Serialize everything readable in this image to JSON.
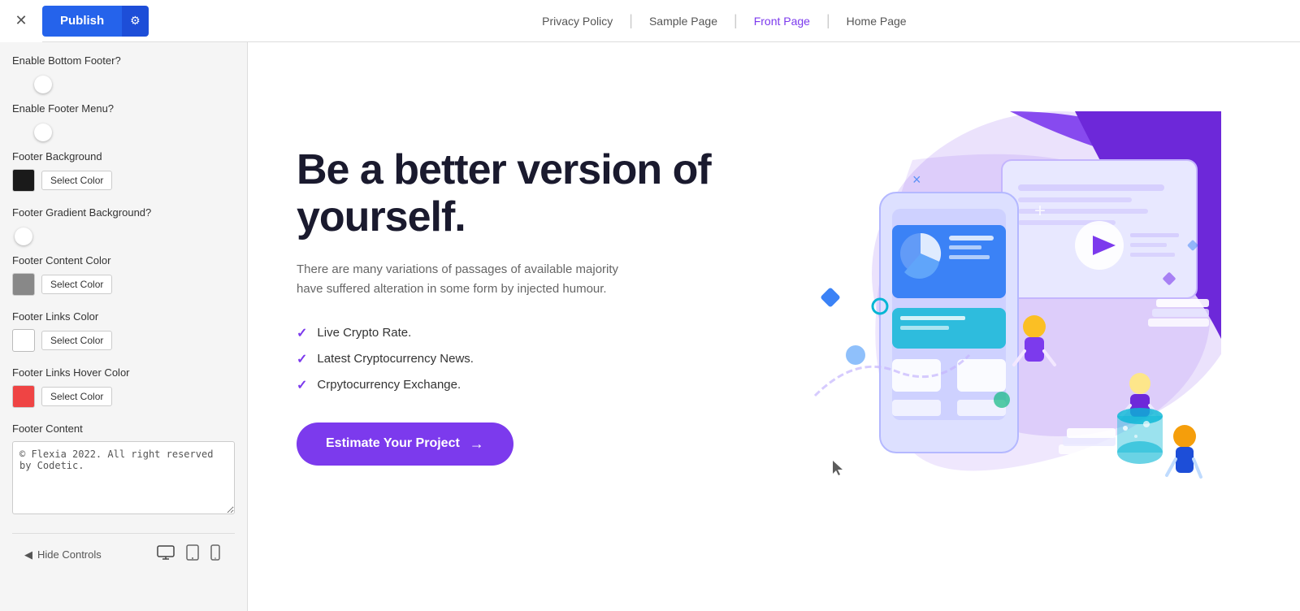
{
  "toolbar": {
    "close_label": "✕",
    "publish_label": "Publish",
    "gear_label": "⚙"
  },
  "top_nav": {
    "items": [
      {
        "label": "Privacy Policy",
        "active": false
      },
      {
        "label": "Sample Page",
        "active": false
      },
      {
        "label": "Front Page",
        "active": true
      },
      {
        "label": "Home Page",
        "active": false
      }
    ]
  },
  "left_panel": {
    "settings": [
      {
        "id": "enable-bottom-footer",
        "label": "Enable Bottom Footer?",
        "type": "toggle",
        "value": true
      },
      {
        "id": "enable-footer-menu",
        "label": "Enable Footer Menu?",
        "type": "toggle",
        "value": true
      },
      {
        "id": "footer-background",
        "label": "Footer Background",
        "type": "color",
        "color": "#1a1a1a",
        "button_label": "Select Color"
      },
      {
        "id": "footer-gradient",
        "label": "Footer Gradient Background?",
        "type": "toggle",
        "value": false
      },
      {
        "id": "footer-content-color",
        "label": "Footer Content Color",
        "type": "color",
        "color": "#888888",
        "button_label": "Select Color"
      },
      {
        "id": "footer-links-color",
        "label": "Footer Links Color",
        "type": "color",
        "color": "#ffffff",
        "button_label": "Select Color"
      },
      {
        "id": "footer-links-hover-color",
        "label": "Footer Links Hover Color",
        "type": "color",
        "color": "#ef4444",
        "button_label": "Select Color"
      },
      {
        "id": "footer-content",
        "label": "Footer Content",
        "type": "textarea",
        "value": "© Flexia 2022. All right reserved by Codetic."
      }
    ],
    "bottom": {
      "hide_controls_label": "Hide Controls",
      "hide_controls_icon": "◀"
    }
  },
  "preview": {
    "nav": {
      "items": [
        {
          "label": "Privacy Policy",
          "active": false
        },
        {
          "label": "Sample Page",
          "active": false
        },
        {
          "label": "Front Page",
          "active": true
        },
        {
          "label": "Home Page",
          "active": false
        }
      ]
    },
    "hero": {
      "title": "Be a better version of yourself.",
      "subtitle": "There are many variations of passages of available majority have suffered alteration in some form by injected humour.",
      "list_items": [
        "Live Crypto Rate.",
        "Latest Cryptocurrency News.",
        "Crpytocurrency Exchange."
      ],
      "button_label": "Estimate Your Project",
      "button_arrow": "→"
    }
  }
}
